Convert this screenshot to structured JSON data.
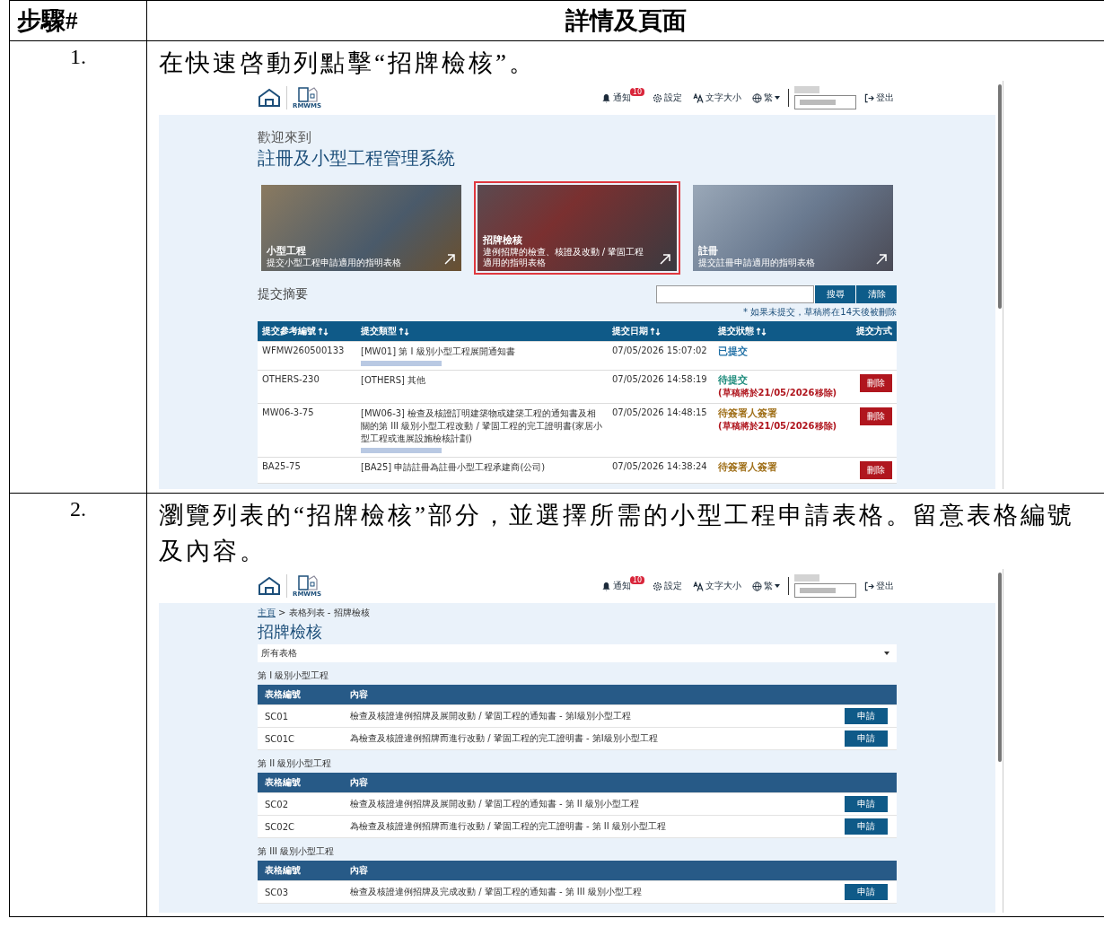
{
  "table": {
    "columns": [
      "步驟#",
      "詳情及頁面"
    ],
    "steps": [
      {
        "number": "1.",
        "instruction": "在快速啓動列點擊“招牌檢核”。",
        "screen": {
          "kind": "home",
          "header": {
            "logo_text": "RMWMS",
            "badge": "10",
            "notify": "通知",
            "settings": "設定",
            "font_size": "文字大小",
            "language": "繁",
            "logout": "登出"
          },
          "welcome": "歡迎來到",
          "title": "註冊及小型工程管理系統",
          "cards": [
            {
              "title": "小型工程",
              "desc": "提交小型工程申請適用的指明表格",
              "selected": false
            },
            {
              "title": "招牌檢核",
              "desc": "違例招牌的檢查、核證及改動 / 鞏固工程適用的指明表格",
              "selected": true
            },
            {
              "title": "註冊",
              "desc": "提交註冊申請適用的指明表格",
              "selected": false
            }
          ],
          "summary": {
            "title": "提交摘要",
            "search_button": "搜尋",
            "clear_button": "清除",
            "note": "* 如果未提交，草稿將在14天後被刪除",
            "columns": [
              {
                "label": "提交參考編號",
                "sortable": true
              },
              {
                "label": "提交類型",
                "sortable": true
              },
              {
                "label": "提交日期",
                "sortable": true
              },
              {
                "label": "提交狀態",
                "sortable": true
              },
              {
                "label": "提交方式",
                "sortable": false
              }
            ],
            "rows": [
              {
                "ref": "WFMW260500133",
                "type": "[MW01] 第 I 級別小型工程展開通知書",
                "redacted": true,
                "date": "07/05/2026 15:07:02",
                "status": "已提交",
                "color": "#1f6fa5"
              },
              {
                "ref": "OTHERS-230",
                "type": "[OTHERS] 其他",
                "redacted": false,
                "date": "07/05/2026 14:58:19",
                "status": "待提交",
                "color": "#1a8a7a",
                "removal": "(草稿將於21/05/2026移除)",
                "action": "刪除"
              },
              {
                "ref": "MW06-3-75",
                "type": "[MW06-3] 檢查及核證訂明建築物或建築工程的通知書及相關的第 III 級別小型工程改動 / 鞏固工程的完工證明書(家居小型工程或進展設施檢核計劃)",
                "redacted": true,
                "date": "07/05/2026 14:48:15",
                "status": "待簽署人簽署",
                "color": "#a0701a",
                "removal": "(草稿將於21/05/2026移除)",
                "action": "刪除"
              },
              {
                "ref": "BA25-75",
                "type": "[BA25] 申請註冊為註冊小型工程承建商(公司)",
                "redacted": false,
                "date": "07/05/2026 14:38:24",
                "status": "待簽署人簽署",
                "color": "#a0701a",
                "action": "刪除"
              }
            ]
          }
        }
      },
      {
        "number": "2.",
        "instruction": "瀏覽列表的“招牌檢核”部分，並選擇所需的小型工程申請表格。留意表格編號及內容。",
        "screen": {
          "kind": "forms",
          "header": {
            "logo_text": "RMWMS",
            "badge": "10",
            "notify": "通知",
            "settings": "設定",
            "font_size": "文字大小",
            "language": "繁",
            "logout": "登出"
          },
          "breadcrumb": {
            "home": "主頁",
            "current": "> 表格列表 - 招牌檢核"
          },
          "title": "招牌檢核",
          "filter": "所有表格",
          "groups": [
            {
              "title": "第 I 級別小型工程",
              "columns": [
                "表格編號",
                "內容"
              ],
              "rows": [
                {
                  "code": "SC01",
                  "content": "檢查及核證違例招牌及展開改動 / 鞏固工程的通知書 - 第I級別小型工程",
                  "button": "申請"
                },
                {
                  "code": "SC01C",
                  "content": "為檢查及核證違例招牌而進行改動 / 鞏固工程的完工證明書 - 第I級別小型工程",
                  "button": "申請"
                }
              ]
            },
            {
              "title": "第 II 級別小型工程",
              "columns": [
                "表格編號",
                "內容"
              ],
              "rows": [
                {
                  "code": "SC02",
                  "content": "檢查及核證違例招牌及展開改動 / 鞏固工程的通知書 - 第 II 級別小型工程",
                  "button": "申請"
                },
                {
                  "code": "SC02C",
                  "content": "為檢查及核證違例招牌而進行改動 / 鞏固工程的完工證明書 - 第 II 級別小型工程",
                  "button": "申請"
                }
              ]
            },
            {
              "title": "第 III 級別小型工程",
              "columns": [
                "表格編號",
                "內容"
              ],
              "rows": [
                {
                  "code": "SC03",
                  "content": "檢查及核證違例招牌及完成改動 / 鞏固工程的通知書 - 第 III 級別小型工程",
                  "button": "申請"
                }
              ]
            }
          ]
        }
      }
    ]
  }
}
